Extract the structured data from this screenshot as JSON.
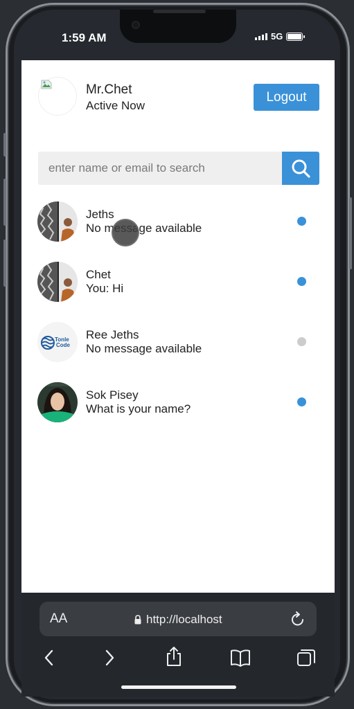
{
  "status_bar": {
    "time": "1:59 AM",
    "network": "5G"
  },
  "header": {
    "user_name": "Mr.Chet",
    "user_status": "Active Now",
    "logout_label": "Logout"
  },
  "search": {
    "placeholder": "enter name or email to search"
  },
  "contacts": [
    {
      "name": "Jeths",
      "message": "No message available",
      "online": true
    },
    {
      "name": "Chet",
      "message": "You: Hi",
      "online": true
    },
    {
      "name": "Ree Jeths",
      "message": "No message available",
      "online": false,
      "logo_text": "Tonle Code"
    },
    {
      "name": "Sok Pisey",
      "message": "What is your name?",
      "online": true
    }
  ],
  "colors": {
    "accent": "#3a91d8",
    "online": "#3a91d8",
    "offline": "#cccccc"
  },
  "browser": {
    "text_size_label": "AA",
    "url": "http://localhost"
  }
}
